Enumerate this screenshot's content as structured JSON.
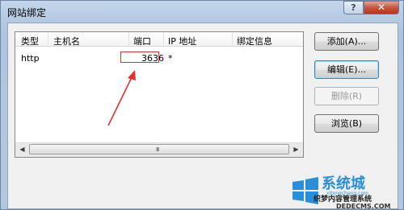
{
  "window": {
    "title": "网站绑定",
    "help_glyph": "?",
    "close_glyph": "✕"
  },
  "list": {
    "columns": [
      "类型",
      "主机名",
      "端口",
      "IP 地址",
      "绑定信息"
    ],
    "rows": [
      {
        "type": "http",
        "host": "",
        "port": "3636",
        "ip": "*",
        "info": ""
      }
    ],
    "scroll_grip": "III"
  },
  "buttons": {
    "add": "添加(A)...",
    "edit": "编辑(E)...",
    "remove": "删除(R)",
    "browse": "浏览(B)"
  },
  "watermark": {
    "line1": "系统城",
    "line2": "xitongcheng.com",
    "line3": "织梦内容管理系统",
    "line4": "DEDECMS.COM"
  },
  "colors": {
    "highlight": "#e0312b"
  }
}
